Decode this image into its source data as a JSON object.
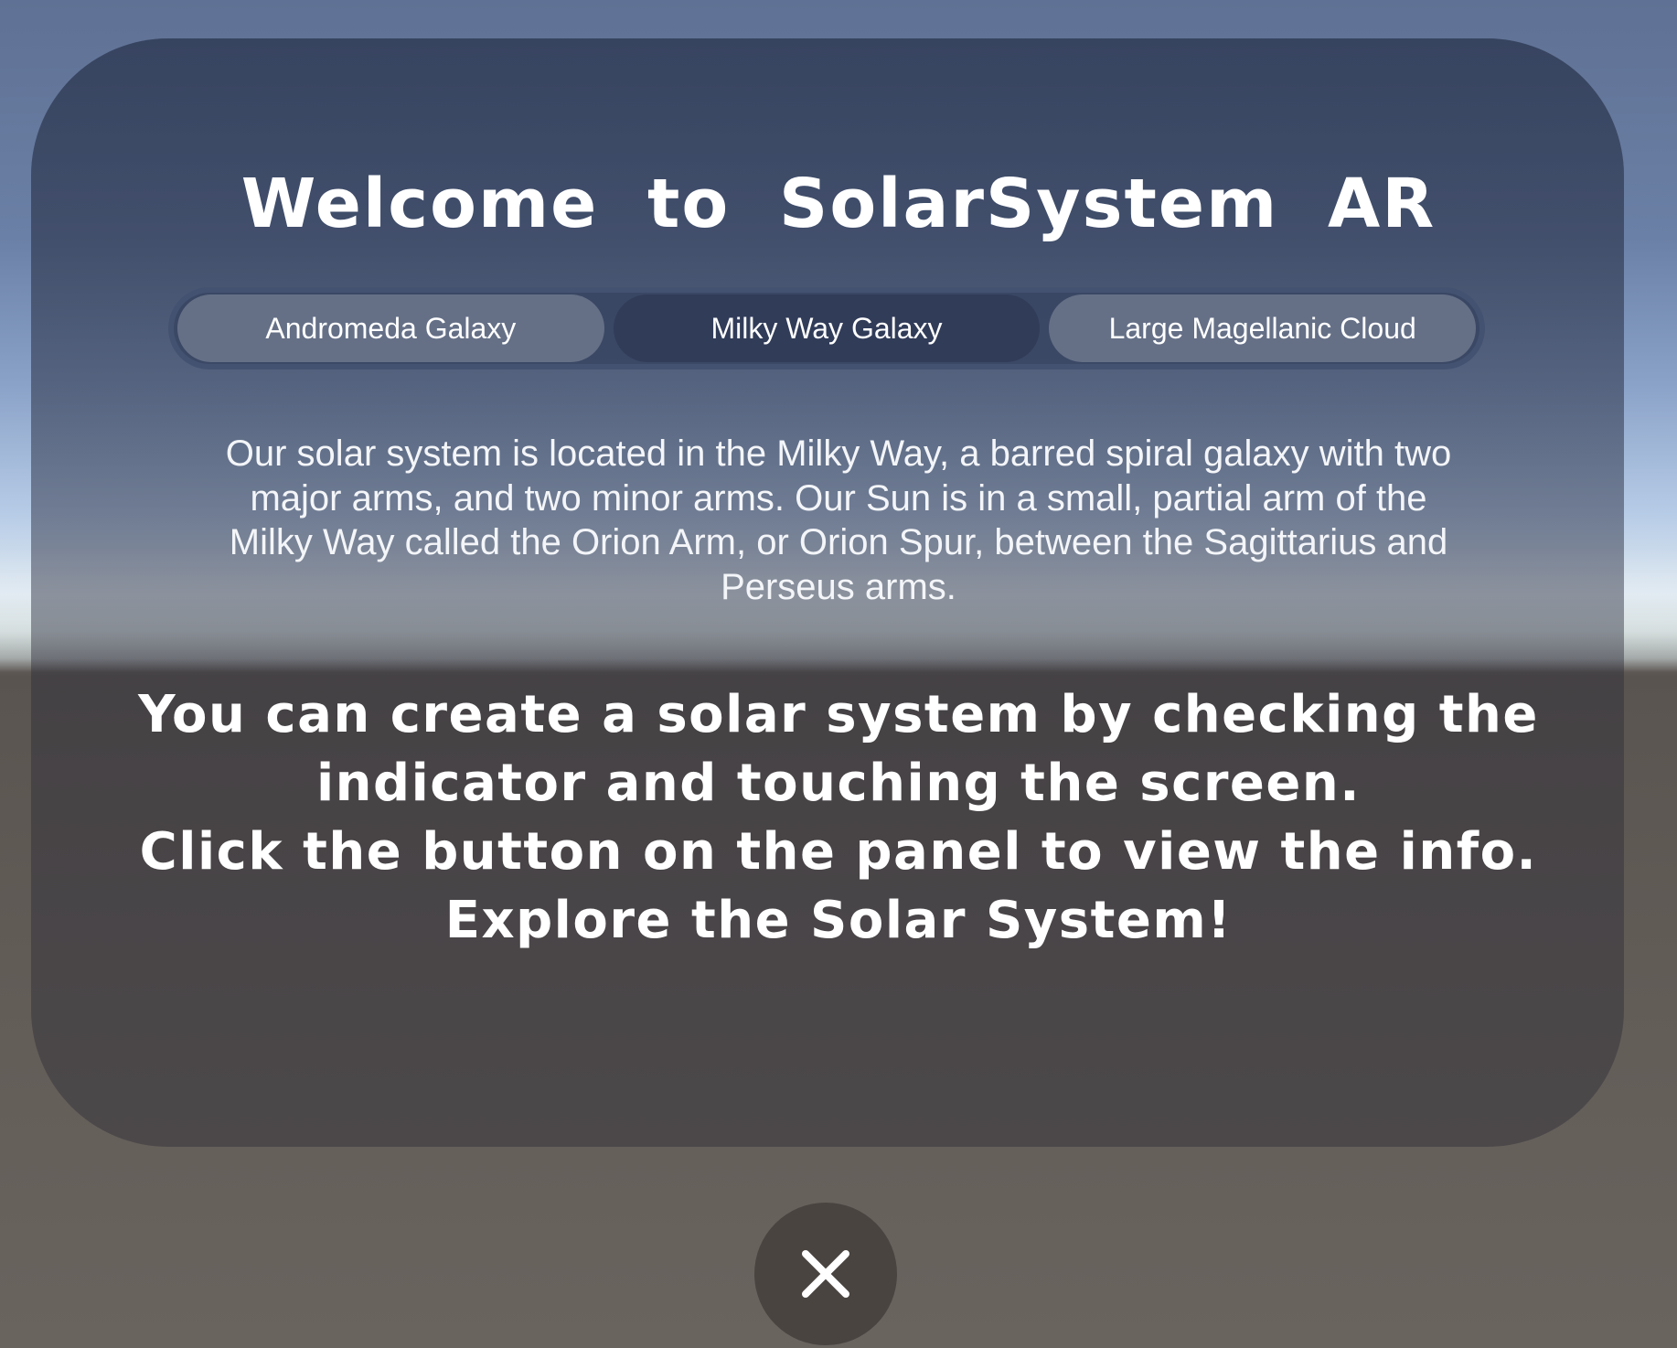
{
  "panel": {
    "title": "Welcome  to  SolarSystem  AR",
    "tabs": [
      {
        "label": "Andromeda Galaxy",
        "selected": false
      },
      {
        "label": "Milky Way Galaxy",
        "selected": true
      },
      {
        "label": "Large Magellanic Cloud",
        "selected": false
      }
    ],
    "description": "Our solar system is located in the Milky Way, a barred spiral galaxy with two major arms, and two minor arms. Our Sun is in a small, partial arm of the Milky Way called the Orion Arm, or Orion Spur, between the Sagittarius and Perseus arms.",
    "instructions": [
      "You can create a solar system by checking the",
      "indicator and touching the screen.",
      "Click the button on the panel to view the info.",
      "Explore the Solar System!"
    ]
  },
  "close_button": {
    "icon": "close-icon"
  },
  "colors": {
    "tab_active": "#303c58",
    "tab_inactive": "#78829680",
    "text": "#ffffff"
  }
}
